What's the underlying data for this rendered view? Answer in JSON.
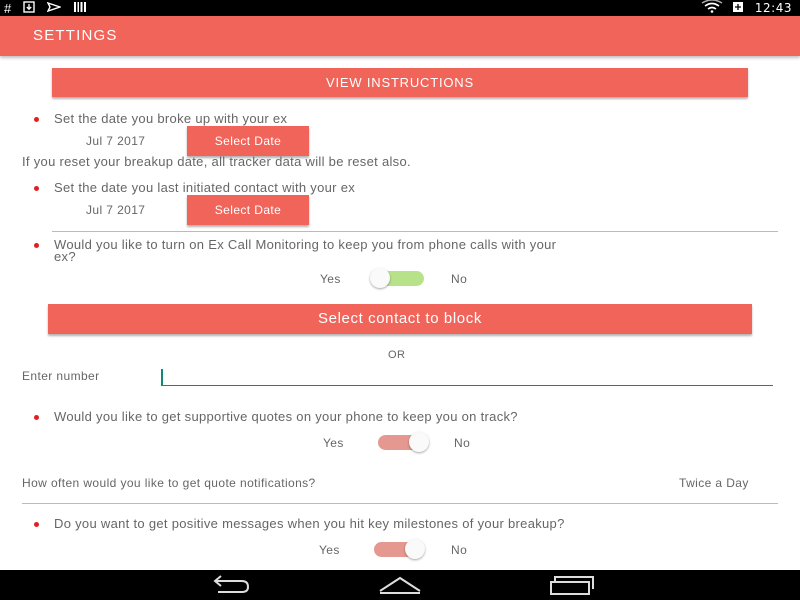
{
  "status_bar": {
    "left_icons": [
      "hash-icon",
      "download-icon",
      "send-icon",
      "barcode-icon"
    ],
    "right_icons": [
      "wifi-icon",
      "battery-icon"
    ],
    "time": "12:43"
  },
  "app_bar": {
    "title": "SETTINGS"
  },
  "view_instructions": {
    "label": "VIEW INSTRUCTIONS"
  },
  "breakup": {
    "question": "Set the date you broke up with your ex",
    "date": "Jul 7 2017",
    "button": "Select Date",
    "note": "If you reset your breakup date, all tracker data will be reset also."
  },
  "contact": {
    "question": "Set the date you last initiated contact with your ex",
    "date": "Jul 7 2017",
    "button": "Select Date"
  },
  "call_monitoring": {
    "question_line1": "Would you like to turn on Ex Call Monitoring to keep you from phone calls with your",
    "question_line2": "ex?",
    "yes": "Yes",
    "no": "No",
    "state": "off"
  },
  "block": {
    "button": "Select contact to block",
    "or": "OR",
    "field_label": "Enter number",
    "field_value": ""
  },
  "quotes": {
    "question": "Would you like to get supportive quotes on your phone to keep you on track?",
    "yes": "Yes",
    "no": "No",
    "state": "on",
    "frequency_label": "How often would you like to get quote notifications?",
    "frequency_value": "Twice a Day"
  },
  "milestones": {
    "question": "Do you want to get positive messages when you hit key milestones of your breakup?",
    "yes": "Yes",
    "no": "No",
    "state": "on"
  },
  "nav": [
    "back-icon",
    "home-icon",
    "recents-icon"
  ],
  "colors": {
    "accent": "#f0645a",
    "bullet": "#e02020",
    "switch_off": "#b8e28a",
    "switch_on": "#e4988f",
    "input_line": "#0d8a7a"
  }
}
